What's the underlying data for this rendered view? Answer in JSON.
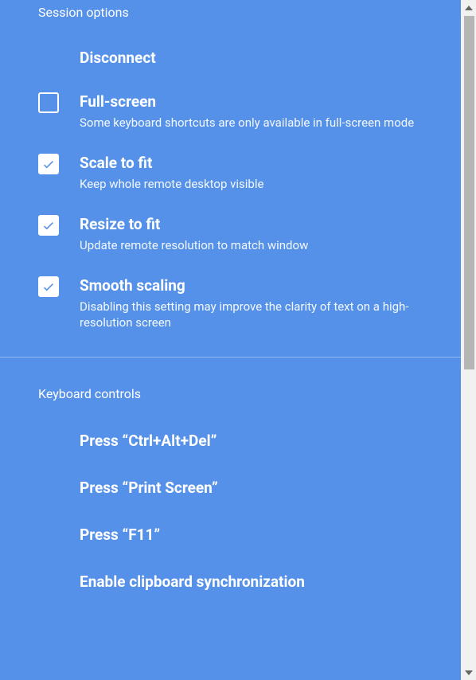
{
  "session": {
    "title": "Session options",
    "disconnect": {
      "label": "Disconnect"
    },
    "fullscreen": {
      "label": "Full-screen",
      "desc": "Some keyboard shortcuts are only available in full-screen mode",
      "checked": false
    },
    "scale_to_fit": {
      "label": "Scale to fit",
      "desc": "Keep whole remote desktop visible",
      "checked": true
    },
    "resize_to_fit": {
      "label": "Resize to fit",
      "desc": "Update remote resolution to match window",
      "checked": true
    },
    "smooth_scaling": {
      "label": "Smooth scaling",
      "desc": "Disabling this setting may improve the clarity of text on a high-resolution screen",
      "checked": true
    }
  },
  "keyboard": {
    "title": "Keyboard controls",
    "ctrl_alt_del": {
      "label": "Press “Ctrl+Alt+Del”"
    },
    "print_screen": {
      "label": "Press “Print Screen”"
    },
    "f11": {
      "label": "Press “F11”"
    },
    "clipboard_sync": {
      "label": "Enable clipboard synchronization"
    }
  },
  "colors": {
    "panel_bg": "#5591e8",
    "scrollbar_thumb": "#b5b5b5"
  }
}
